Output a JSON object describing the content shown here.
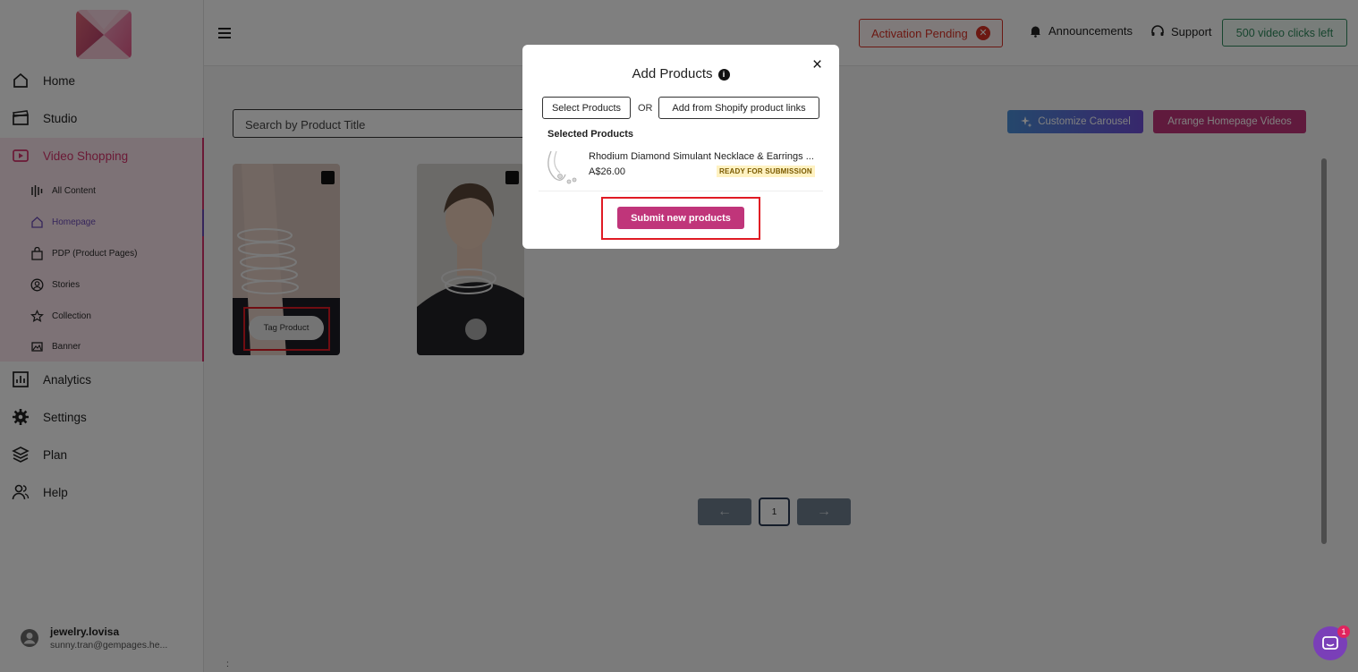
{
  "sidebar": {
    "nav": {
      "home": "Home",
      "studio": "Studio",
      "video_shopping": "Video Shopping",
      "analytics": "Analytics",
      "settings": "Settings",
      "plan": "Plan",
      "help": "Help"
    },
    "sub": {
      "all_content": "All Content",
      "homepage": "Homepage",
      "pdp": "PDP (Product Pages)",
      "stories": "Stories",
      "collection": "Collection",
      "banner": "Banner"
    },
    "user": {
      "name": "jewelry.lovisa",
      "email": "sunny.tran@gempages.he..."
    }
  },
  "topbar": {
    "activation": "Activation Pending",
    "announcements": "Announcements",
    "support": "Support",
    "clicks": "500 video clicks left"
  },
  "main": {
    "search_placeholder": "Search by Product Title",
    "customize_carousel": "Customize Carousel",
    "arrange_videos": "Arrange Homepage Videos",
    "tag_product": "Tag Product",
    "pagination": {
      "page": "1",
      "prev": "←",
      "next": "→"
    },
    "dots": ":"
  },
  "chat": {
    "badge": "1"
  },
  "modal": {
    "title": "Add Products",
    "info": "i",
    "close": "×",
    "select_products": "Select Products",
    "or": "OR",
    "add_links": "Add from Shopify product links",
    "selected_heading": "Selected Products",
    "product": {
      "name": "Rhodium Diamond Simulant Necklace & Earrings ...",
      "price": "A$26.00",
      "status": "READY FOR SUBMISSION"
    },
    "submit": "Submit new products"
  },
  "colors": {
    "accent_pink": "#c0357a",
    "active_nav": "#d6336c",
    "pending_red": "#d93025",
    "clicks_green": "#2e8a5c",
    "highlight_red": "#e01b24"
  }
}
